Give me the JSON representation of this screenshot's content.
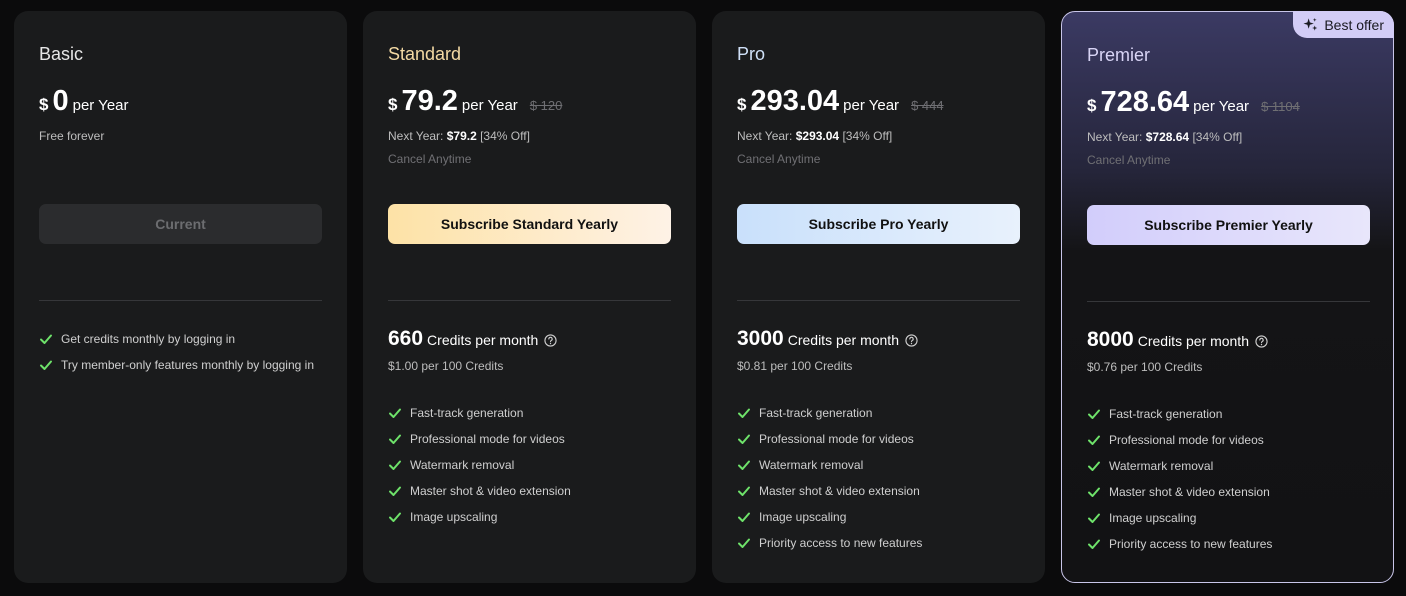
{
  "plans": [
    {
      "name": "Basic",
      "currency": "$",
      "price": "0",
      "period": "per Year",
      "free_note": "Free forever",
      "button": "Current",
      "features": [
        "Get credits monthly by logging in",
        "Try member-only features monthly by logging in"
      ]
    },
    {
      "name": "Standard",
      "currency": "$",
      "price": "79.2",
      "period": "per Year",
      "old_price": "$ 120",
      "next_year_label": "Next Year:",
      "next_year_price": "$79.2",
      "discount": "[34% Off]",
      "cancel": "Cancel Anytime",
      "button": "Subscribe Standard Yearly",
      "credits": "660",
      "credits_label": "Credits per month",
      "rate": "$1.00 per 100 Credits",
      "features": [
        "Fast-track generation",
        "Professional mode for videos",
        "Watermark removal",
        "Master shot & video extension",
        "Image upscaling"
      ]
    },
    {
      "name": "Pro",
      "currency": "$",
      "price": "293.04",
      "period": "per Year",
      "old_price": "$ 444",
      "next_year_label": "Next Year:",
      "next_year_price": "$293.04",
      "discount": "[34% Off]",
      "cancel": "Cancel Anytime",
      "button": "Subscribe Pro Yearly",
      "credits": "3000",
      "credits_label": "Credits per month",
      "rate": "$0.81 per 100 Credits",
      "features": [
        "Fast-track generation",
        "Professional mode for videos",
        "Watermark removal",
        "Master shot & video extension",
        "Image upscaling",
        "Priority access to new features"
      ]
    },
    {
      "name": "Premier",
      "badge": "Best offer",
      "currency": "$",
      "price": "728.64",
      "period": "per Year",
      "old_price": "$ 1104",
      "next_year_label": "Next Year:",
      "next_year_price": "$728.64",
      "discount": "[34% Off]",
      "cancel": "Cancel Anytime",
      "button": "Subscribe Premier Yearly",
      "credits": "8000",
      "credits_label": "Credits per month",
      "rate": "$0.76 per 100 Credits",
      "features": [
        "Fast-track generation",
        "Professional mode for videos",
        "Watermark removal",
        "Master shot & video extension",
        "Image upscaling",
        "Priority access to new features"
      ]
    }
  ],
  "colors": {
    "check": "#6ee26a",
    "standard_accent": "#fde2a6",
    "pro_accent": "#c9e0fb",
    "premier_accent": "#d2cdfb"
  },
  "icons": {
    "check": "check-icon",
    "help": "help-circle-icon",
    "sparkle": "sparkle-icon"
  }
}
